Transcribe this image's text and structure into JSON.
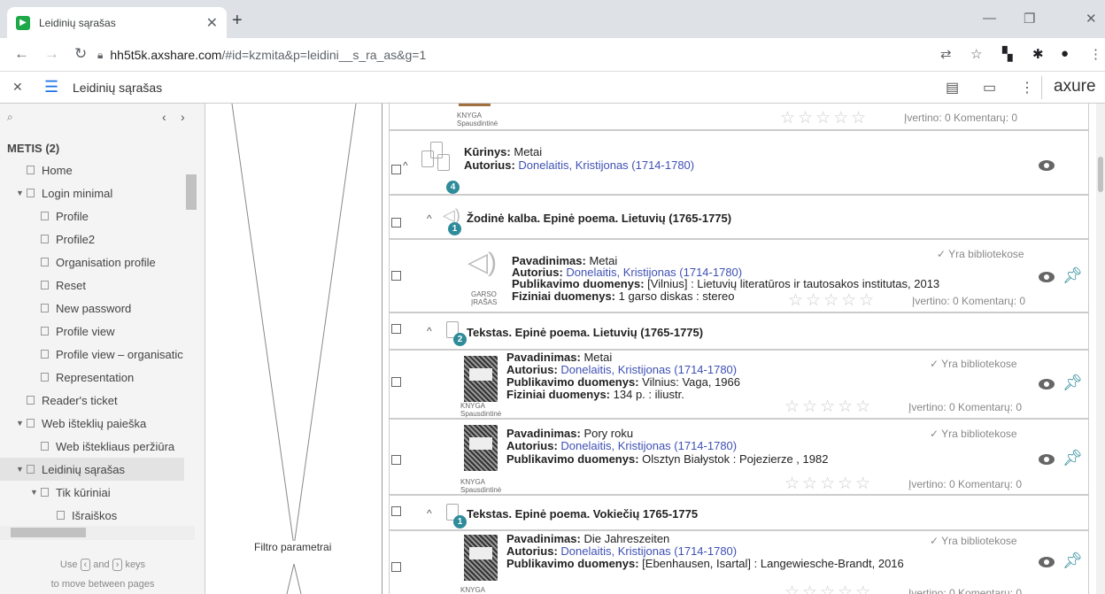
{
  "browser": {
    "tab_title": "Leidinių sąrašas",
    "url_host": "hh5t5k.axshare.com",
    "url_path": "/#id=kzmita&p=leidini__s_ra_as&g=1"
  },
  "axure": {
    "page_title": "Leidinių sąrašas",
    "brand": "axure"
  },
  "sidebar": {
    "project": "METIS (2)",
    "pages": [
      {
        "label": "Home",
        "indent": 1,
        "tri": ""
      },
      {
        "label": "Login minimal",
        "indent": 1,
        "tri": "▼"
      },
      {
        "label": "Profile",
        "indent": 2,
        "tri": ""
      },
      {
        "label": "Profile2",
        "indent": 2,
        "tri": ""
      },
      {
        "label": "Organisation profile",
        "indent": 2,
        "tri": ""
      },
      {
        "label": "Reset",
        "indent": 2,
        "tri": ""
      },
      {
        "label": "New password",
        "indent": 2,
        "tri": ""
      },
      {
        "label": "Profile view",
        "indent": 2,
        "tri": ""
      },
      {
        "label": "Profile view – organisatic",
        "indent": 2,
        "tri": ""
      },
      {
        "label": "Representation",
        "indent": 2,
        "tri": ""
      },
      {
        "label": "Reader's ticket",
        "indent": 1,
        "tri": ""
      },
      {
        "label": "Web išteklių paieška",
        "indent": 1,
        "tri": "▼"
      },
      {
        "label": "Web ištekliaus peržiūra",
        "indent": 2,
        "tri": ""
      },
      {
        "label": "Leidinių sąrašas",
        "indent": 1,
        "tri": "▼",
        "selected": true
      },
      {
        "label": "Tik kūriniai",
        "indent": 2,
        "tri": "▼"
      },
      {
        "label": "Išraiškos",
        "indent": 3,
        "tri": ""
      }
    ],
    "hint_1": "Use",
    "hint_and": "and",
    "hint_keys": "keys",
    "hint_2": "to move between pages"
  },
  "filter": {
    "label": "Filtro parametrai"
  },
  "labels": {
    "pav": "Pavadinimas:",
    "aut": "Autorius:",
    "pub": "Publikavimo duomenys:",
    "fiz": "Fiziniai duomenys:",
    "kurinys": "Kūrinys:",
    "avail": "✓ Yra bibliotekose",
    "rating": "Įvertino: 0  Komentarų: 0",
    "knyga": "KNYGA",
    "spausd": "Spausdintinė",
    "garso1": "GARSO",
    "garso2": "ĮRAŠAS"
  },
  "content": {
    "work_title": "Metai",
    "author": "Donelaitis, Kristijonas (1714-1780)",
    "group1": "Žodinė kalba. Epinė poema. Lietuvių (1765-1775)",
    "group2": "Tekstas. Epinė poema. Lietuvių (1765-1775)",
    "group3": "Tekstas.  Epinė poema. Vokiečių 1765-1775",
    "badge_work": "4",
    "badge_g1": "1",
    "badge_g2": "2",
    "badge_g3": "1",
    "audio": {
      "title": "Metai",
      "pub": "[Vilnius] : Lietuvių literatūros ir tautosakos institutas, 2013",
      "phys": "1 garso diskas : stereo"
    },
    "book1": {
      "title": "Metai",
      "pub": "Vilnius: Vaga, 1966",
      "phys": "134 p. : iliustr."
    },
    "book2": {
      "title": "Pory roku",
      "pub": "Olsztyn Białystok : Pojezierze , 1982"
    },
    "book3": {
      "title": "Die Jahreszeiten",
      "pub": " [Ebenhausen, Isartal] : Langewiesche-Brandt, 2016"
    }
  }
}
